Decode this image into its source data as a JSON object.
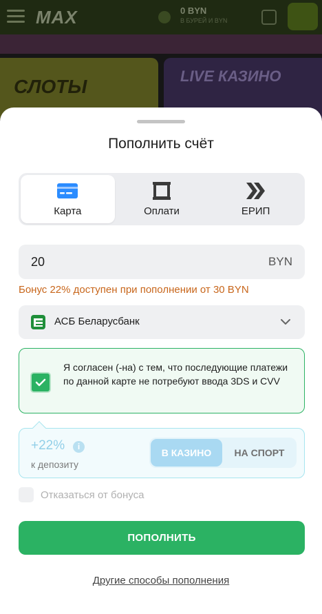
{
  "background": {
    "logo": "MAX",
    "balance": "0 BYN",
    "balance_sub": "В БУРЕЙ И BYN",
    "category_slots": "СЛОТЫ",
    "category_live": "LIVE КАЗИНО"
  },
  "sheet": {
    "title": "Пополнить счёт",
    "tabs": [
      {
        "label": "Карта",
        "icon": "credit-card-icon",
        "active": true
      },
      {
        "label": "Оплати",
        "icon": "oplati-icon",
        "active": false
      },
      {
        "label": "ЕРИП",
        "icon": "erip-icon",
        "active": false
      }
    ],
    "amount": {
      "value": "20",
      "currency": "BYN"
    },
    "bonus_note": "Бонус 22% доступен при пополнении от 30 BYN",
    "bank": {
      "name": "АСБ Беларусбанк",
      "icon": "belarusbank-logo"
    },
    "consent": {
      "checked": true,
      "text": "Я согласен (-на) с тем, что последующие платежи по данной карте не потребуют ввода 3DS и CVV"
    },
    "promo": {
      "percent": "+22%",
      "subtitle": "к депозиту",
      "options": [
        "В КАЗИНО",
        "НА СПОРТ"
      ],
      "selected": "В КАЗИНО"
    },
    "decline_bonus": {
      "label": "Отказаться от бонуса",
      "checked": false
    },
    "submit_label": "ПОПОЛНИТЬ",
    "other_methods_link": "Другие способы пополнения"
  },
  "colors": {
    "accent_green": "#2bb263",
    "bonus_orange": "#c8661b",
    "promo_blue": "#a9d9f2",
    "card_icon_blue": "#2b8cff"
  }
}
